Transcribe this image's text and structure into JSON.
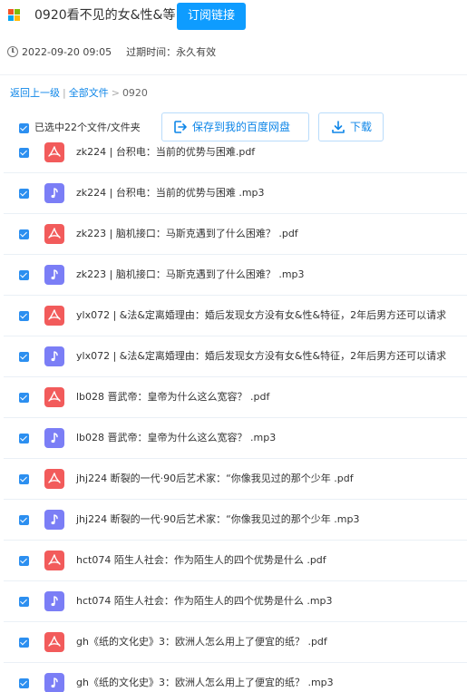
{
  "header": {
    "title": "0920看不见的女&性&等",
    "subscribe_label": "订阅链接"
  },
  "meta": {
    "datetime": "2022-09-20 09:05",
    "expire_label": "过期时间：",
    "expire_value": "永久有效"
  },
  "breadcrumb": {
    "back": "返回上一级",
    "all_files": "全部文件",
    "current": "0920"
  },
  "toolbar": {
    "selected_text": "已选中22个文件/文件夹",
    "save_label": "保存到我的百度网盘",
    "download_label": "下载"
  },
  "colors": {
    "accent": "#0e9cff",
    "pdf_icon": "#f25b5b",
    "audio_icon": "#7b7ef6"
  },
  "files": [
    {
      "name": "zk224 | 台积电：当前的优势与困难.pdf",
      "type": "pdf",
      "icon": "pdf-icon"
    },
    {
      "name": "zk224 | 台积电：当前的优势与困难 .mp3",
      "type": "mp3",
      "icon": "music-note-icon"
    },
    {
      "name": "zk223 | 脑机接口：马斯克遇到了什么困难？ .pdf",
      "type": "pdf",
      "icon": "pdf-icon"
    },
    {
      "name": "zk223 | 脑机接口：马斯克遇到了什么困难？ .mp3",
      "type": "mp3",
      "icon": "music-note-icon"
    },
    {
      "name": "ylx072 | &法&定离婚理由：婚后发现女方没有女&性&特征，2年后男方还可以请求",
      "type": "pdf",
      "icon": "pdf-icon"
    },
    {
      "name": "ylx072 | &法&定离婚理由：婚后发现女方没有女&性&特征，2年后男方还可以请求",
      "type": "mp3",
      "icon": "music-note-icon"
    },
    {
      "name": "lb028 晋武帝：皇帝为什么这么宽容？ .pdf",
      "type": "pdf",
      "icon": "pdf-icon"
    },
    {
      "name": "lb028 晋武帝：皇帝为什么这么宽容？ .mp3",
      "type": "mp3",
      "icon": "music-note-icon"
    },
    {
      "name": "jhj224 断裂的一代·90后艺术家：“你像我见过的那个少年 .pdf",
      "type": "pdf",
      "icon": "pdf-icon"
    },
    {
      "name": "jhj224 断裂的一代·90后艺术家：“你像我见过的那个少年 .mp3",
      "type": "mp3",
      "icon": "music-note-icon"
    },
    {
      "name": "hct074 陌生人社会：作为陌生人的四个优势是什么 .pdf",
      "type": "pdf",
      "icon": "pdf-icon"
    },
    {
      "name": "hct074 陌生人社会：作为陌生人的四个优势是什么 .mp3",
      "type": "mp3",
      "icon": "music-note-icon"
    },
    {
      "name": "gh《纸的文化史》3：欧洲人怎么用上了便宜的纸？ .pdf",
      "type": "pdf",
      "icon": "pdf-icon"
    },
    {
      "name": "gh《纸的文化史》3：欧洲人怎么用上了便宜的纸？ .mp3",
      "type": "mp3",
      "icon": "music-note-icon"
    }
  ]
}
